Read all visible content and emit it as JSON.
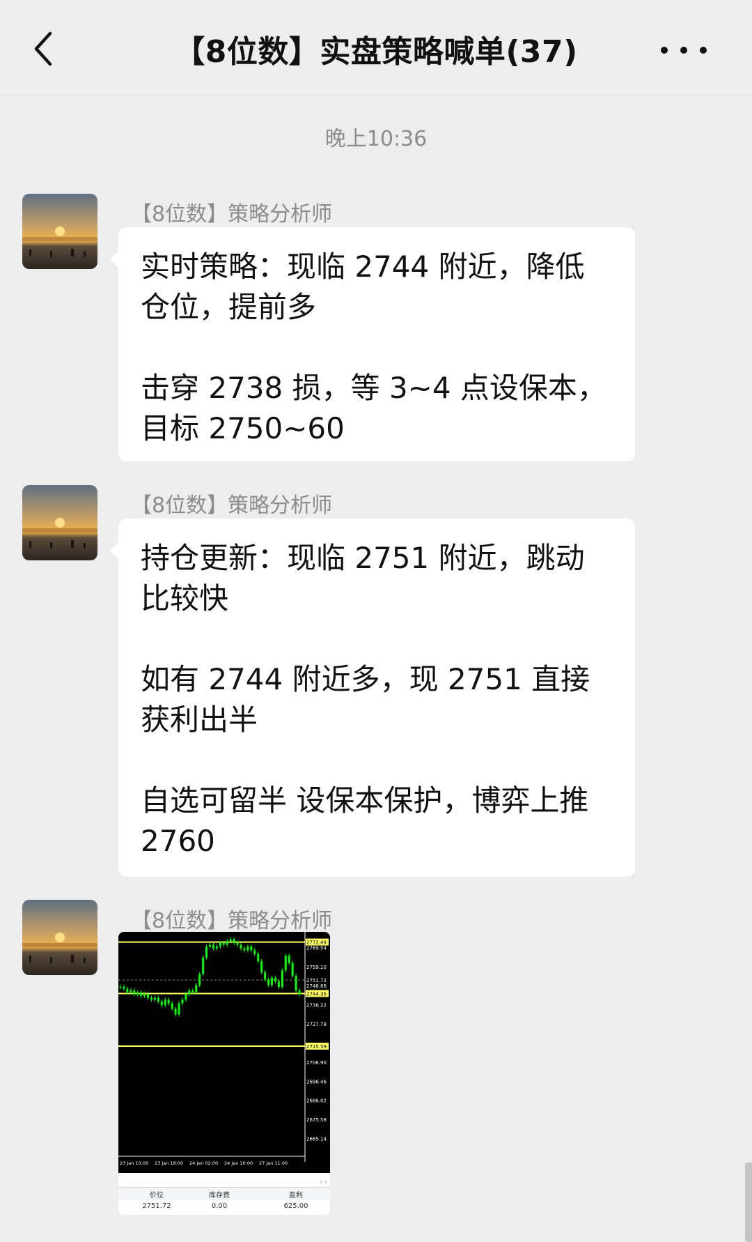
{
  "header": {
    "title": "【8位数】实盘策略喊单(37)"
  },
  "chat": {
    "time": "晚上10:36",
    "messages": [
      {
        "sender": "【8位数】策略分析师",
        "paragraphs": [
          "实时策略：现临 2744 附近，降低仓位，提前多",
          "击穿 2738 损，等 3~4 点设保本，目标 2750~60"
        ]
      },
      {
        "sender": "【8位数】策略分析师",
        "paragraphs": [
          "持仓更新：现临 2751 附近，跳动比较快",
          "如有 2744 附近多，现 2751 直接获利出半",
          "自选可留半 设保本保护，博弈上推 2760"
        ]
      },
      {
        "sender": "【8位数】策略分析师",
        "image": {
          "price_labels": [
            "2772.49",
            "2769.54",
            "2759.10",
            "2751.72",
            "2748.66",
            "2744.35",
            "2738.22",
            "2727.78",
            "2715.59",
            "2706.90",
            "2696.46",
            "2686.02",
            "2675.58",
            "2665.14"
          ],
          "time_labels": [
            "23 Jan 10:00",
            "23 Jan 18:00",
            "24 Jan 02:00",
            "24 Jan 10:00",
            "27 Jan 11:00"
          ],
          "table_headers": [
            "价位",
            "库存费",
            "盈利"
          ],
          "table_row": [
            "2751.72",
            "0.00",
            "625.00"
          ]
        }
      }
    ]
  },
  "colors": {
    "background": "#ededed",
    "bubble": "#ffffff",
    "chart_background": "#000000",
    "candle": "#00ff00",
    "level_line": "#ffff66"
  },
  "icons": [
    "back-arrow-icon",
    "more-dots-icon"
  ]
}
